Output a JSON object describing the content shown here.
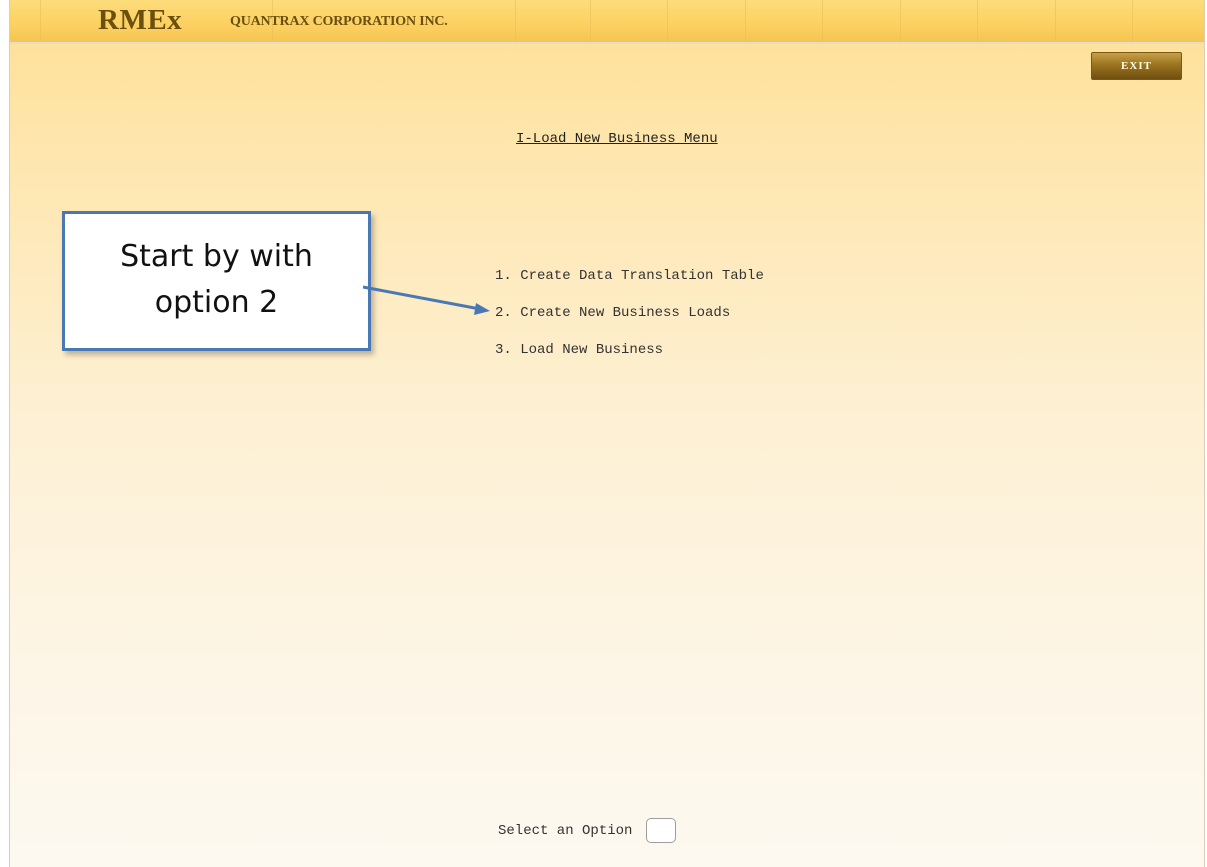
{
  "header": {
    "logo_text": "RMEx",
    "company": "QUANTRAX CORPORATION INC."
  },
  "toolbar": {
    "exit_label": "EXIT"
  },
  "menu": {
    "title": "I-Load New Business Menu",
    "items": [
      {
        "label": "1. Create Data Translation Table"
      },
      {
        "label": "2. Create New Business Loads"
      },
      {
        "label": "3. Load New Business"
      }
    ]
  },
  "callout": {
    "line1": "Start by with",
    "line2": "option 2"
  },
  "select": {
    "label": "Select an Option",
    "value": ""
  }
}
